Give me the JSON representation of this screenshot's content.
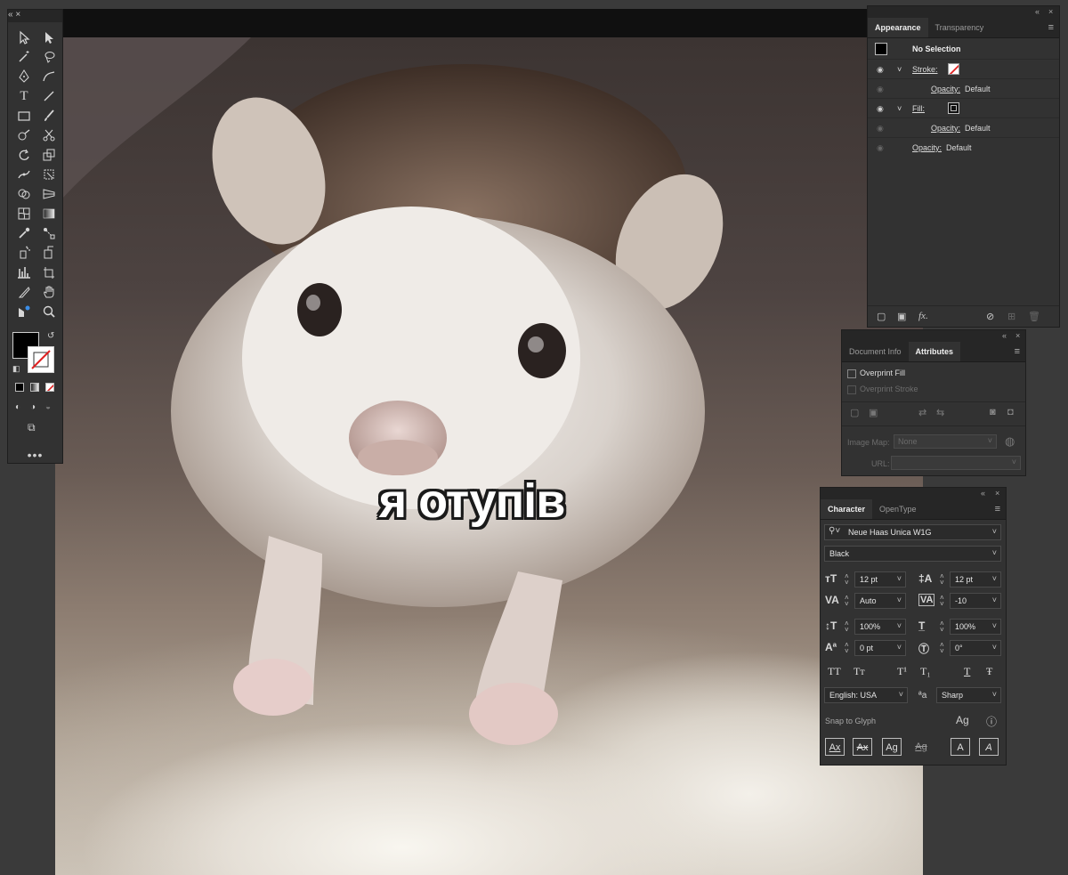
{
  "artwork": {
    "caption": "я отупів"
  },
  "appearance": {
    "tabs": [
      "Appearance",
      "Transparency"
    ],
    "selection_label": "No Selection",
    "rows": [
      {
        "label": "Stroke:",
        "visible": true,
        "expandable": true
      },
      {
        "label": "Opacity:",
        "value": "Default",
        "indent": true
      },
      {
        "label": "Fill:",
        "visible": true,
        "expandable": true
      },
      {
        "label": "Opacity:",
        "value": "Default",
        "indent": true
      },
      {
        "label": "Opacity:",
        "value": "Default"
      }
    ]
  },
  "attributes": {
    "tabs": [
      "Document Info",
      "Attributes"
    ],
    "overprint_fill": "Overprint Fill",
    "overprint_stroke": "Overprint Stroke",
    "image_map_label": "Image Map:",
    "image_map_value": "None",
    "url_label": "URL:"
  },
  "character": {
    "tabs": [
      "Character",
      "OpenType"
    ],
    "font_family": "Neue Haas Unica W1G",
    "font_style": "Black",
    "font_size": "12 pt",
    "leading": "12 pt",
    "kerning": "Auto",
    "tracking": "-10",
    "vertical_scale": "100%",
    "horizontal_scale": "100%",
    "baseline_shift": "0 pt",
    "rotation": "0°",
    "case_buttons": [
      "TT",
      "Tт",
      "T¹",
      "T₁",
      "T",
      "Ŧ"
    ],
    "language": "English: USA",
    "aa_label": "ªa",
    "anti_alias": "Sharp",
    "snap_label": "Snap to Glyph",
    "snap_buttons": [
      "Ax",
      "Ax",
      "Ag",
      "Ag",
      "A",
      "A"
    ]
  },
  "colors": {
    "panel_bg": "#323232",
    "panel_header": "#262626",
    "accent_none": "#e02020"
  }
}
